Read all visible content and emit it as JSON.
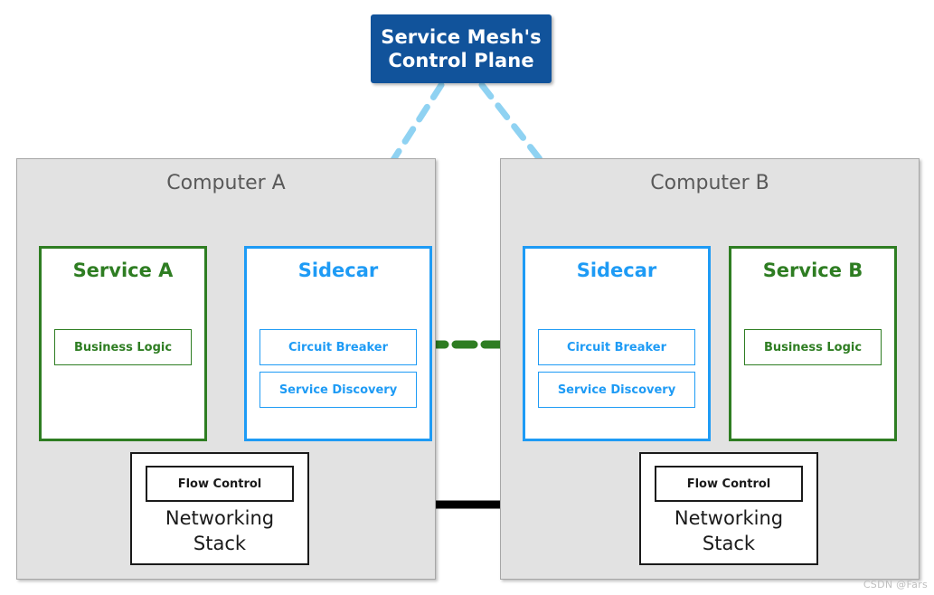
{
  "control_plane": {
    "label": "Service Mesh's\nControl Plane",
    "line1": "Service Mesh's",
    "line2": "Control Plane",
    "color": "#11539B",
    "text_color": "#FFFFFF"
  },
  "computers": [
    {
      "id": "computer-a",
      "title": "Computer A",
      "service": {
        "title": "Service A",
        "color": "#2E7D22",
        "components": [
          "Business Logic"
        ]
      },
      "sidecar": {
        "title": "Sidecar",
        "color": "#1E9BF5",
        "components": [
          "Circuit Breaker",
          "Service Discovery"
        ]
      },
      "networking_stack": {
        "title_line1": "Networking",
        "title_line2": "Stack",
        "components": [
          "Flow Control"
        ],
        "color": "#1A1A1A"
      }
    },
    {
      "id": "computer-b",
      "title": "Computer B",
      "service": {
        "title": "Service B",
        "color": "#2E7D22",
        "components": [
          "Business Logic"
        ]
      },
      "sidecar": {
        "title": "Sidecar",
        "color": "#1E9BF5",
        "components": [
          "Circuit Breaker",
          "Service Discovery"
        ]
      },
      "networking_stack": {
        "title_line1": "Networking",
        "title_line2": "Stack",
        "components": [
          "Flow Control"
        ],
        "color": "#1A1A1A"
      }
    }
  ],
  "connectors": {
    "control_plane_to_sidecar_color": "#8FD2F2",
    "service_to_sidecar_color": "#3D6B2E",
    "sidecar_to_sidecar_color": "#2E7D22",
    "netstack_to_netstack_color": "#000000"
  },
  "canvas": {
    "background": "#FFFFFF",
    "computer_fill": "#E2E2E2",
    "computer_border": "#A6A6A6",
    "computer_title_color": "#595959"
  },
  "watermark": {
    "text": "CSDN @Fars"
  }
}
